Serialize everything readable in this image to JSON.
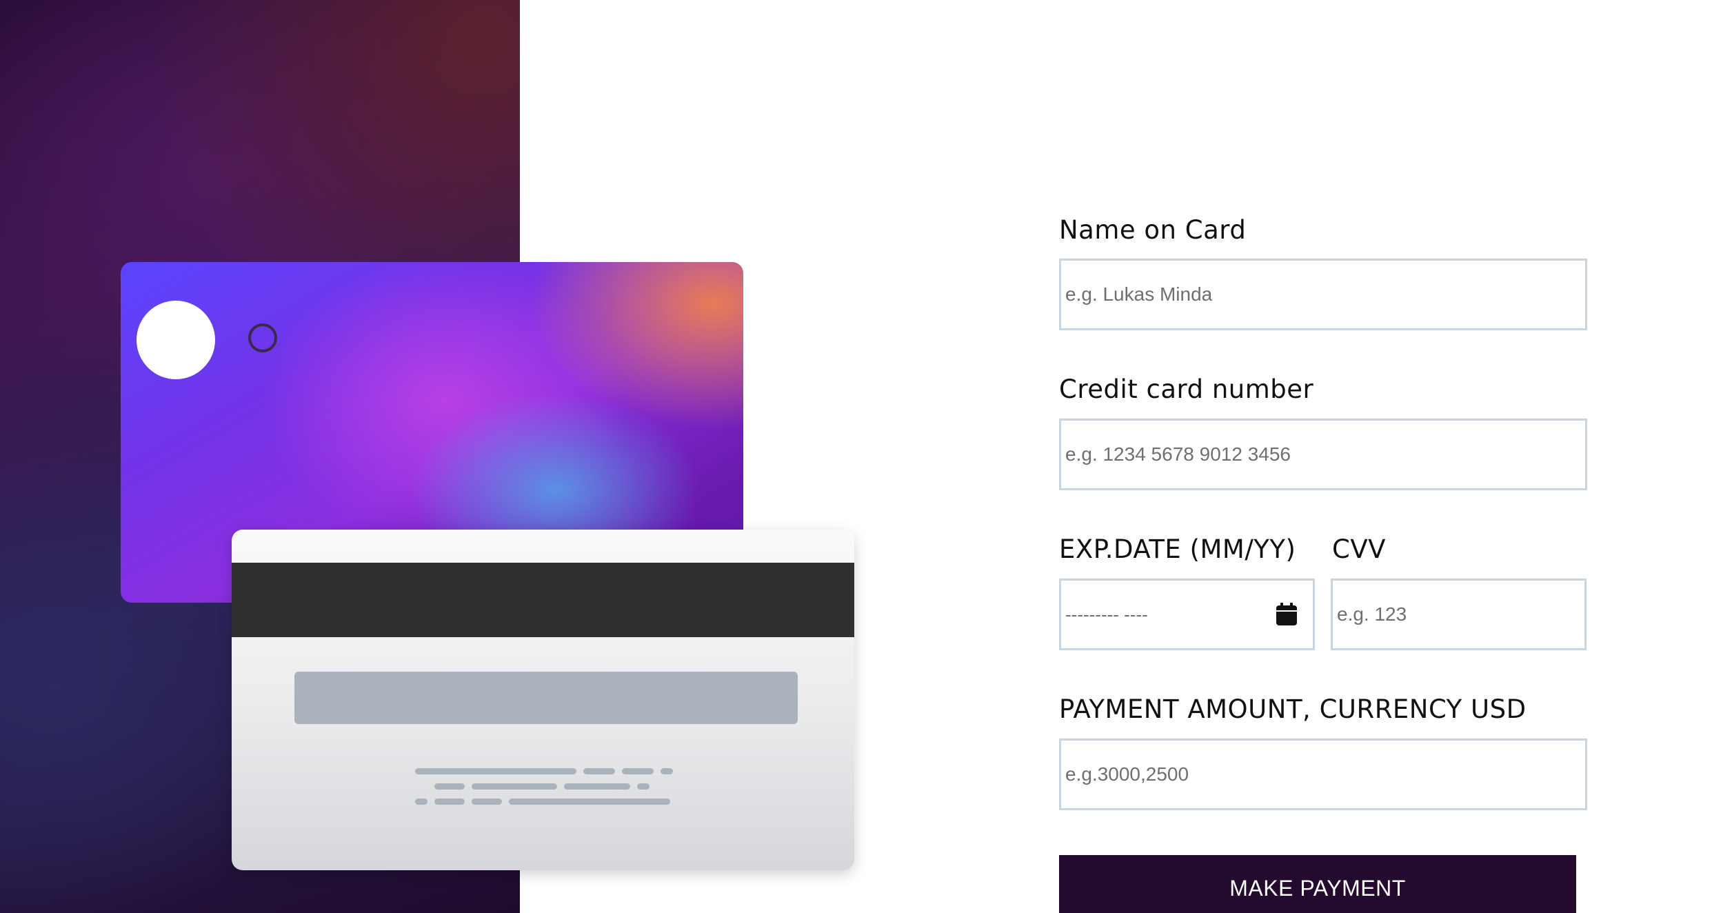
{
  "form": {
    "name": {
      "label": "Name on Card",
      "placeholder": "e.g. Lukas Minda"
    },
    "card_number": {
      "label": "Credit card number",
      "placeholder": "e.g. 1234 5678 9012 3456"
    },
    "exp_date": {
      "label": "EXP.DATE (MM/YY)",
      "value_display": "--------- ----",
      "icon": "calendar-icon"
    },
    "cvv": {
      "label": "CVV",
      "placeholder": "e.g. 123"
    },
    "amount": {
      "label": "PAYMENT AMOUNT, CURRENCY USD",
      "placeholder": "e.g.3000,2500"
    },
    "submit_label": "MAKE PAYMENT"
  },
  "colors": {
    "button_bg": "#240a2e",
    "input_border": "#c9d4df",
    "signature_strip": "#aab3bb",
    "magnetic_stripe": "#2f2f2f"
  }
}
